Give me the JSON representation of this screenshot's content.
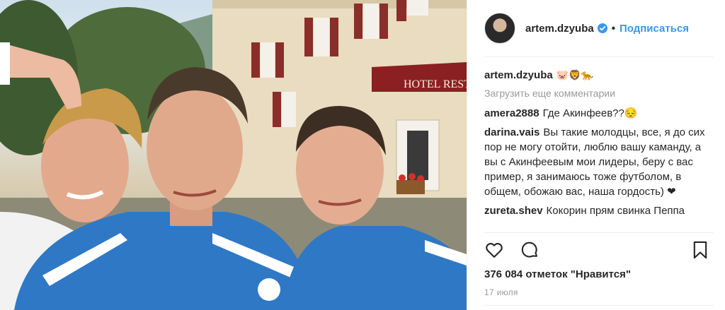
{
  "post": {
    "username": "artem.dzyuba",
    "follow_label": "Подписаться",
    "separator": "•",
    "photo_signs": {
      "hotel_sign": "HOTEL  REST"
    }
  },
  "comments": {
    "caption": {
      "user": "artem.dzyuba",
      "text": "🐷🦁🐆"
    },
    "load_more": "Загрузить еще комментарии",
    "items": [
      {
        "user": "amera2888",
        "text": "Где Акинфеев??😔"
      },
      {
        "user": "darina.vais",
        "text": "Вы такие молодцы, все, я до сих пор не могу отойти, люблю вашу каманду, а вы с Акинфеевым мои лидеры, беру с вас пример, я занимаюсь тоже футболом, в общем, обожаю вас, наша гордость) ❤"
      },
      {
        "user": "zureta.shev",
        "text": "Кокорин прям свинка Пеппа"
      }
    ]
  },
  "actions": {
    "like_icon": "heart-icon",
    "comment_icon": "comment-bubble-icon",
    "save_icon": "bookmark-icon"
  },
  "likes_text": "376 084 отметок \"Нравится\"",
  "date_text": "17 июля",
  "colors": {
    "link": "#3897f0",
    "verified": "#3897f0",
    "muted": "#999999"
  }
}
